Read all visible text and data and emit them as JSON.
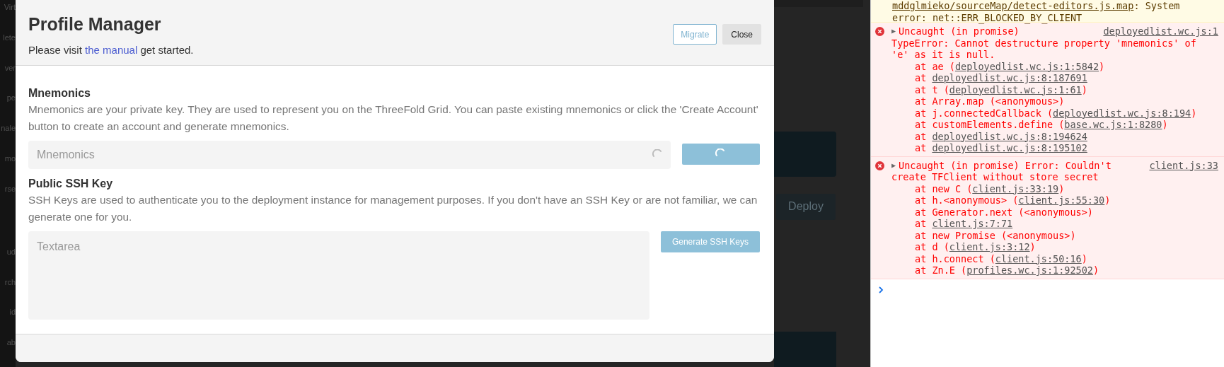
{
  "sidebar": {
    "items": [
      "Virt",
      "lete",
      "ver",
      "pe",
      "nale",
      "mo",
      "rse",
      "ud",
      "rch",
      "id",
      "ab"
    ]
  },
  "modal": {
    "title": "Profile Manager",
    "intro": {
      "before": "Please visit ",
      "link": "the manual",
      "after": " get started."
    },
    "buttons": [
      {
        "label": "Migrate",
        "kind": "outline"
      },
      {
        "label": "Close",
        "kind": "secondary"
      }
    ],
    "sections": [
      {
        "title": "Mnemonics",
        "description": "Mnemonics are your private key. They are used to represent you on the ThreeFold Grid. You can paste existing mnemonics or click the 'Create Account' button to create an account and generate mnemonics.",
        "field": {
          "kind": "input",
          "placeholder": "Mnemonics",
          "loading": true
        },
        "action": {
          "loading": true
        }
      },
      {
        "title": "Public SSH Key",
        "description": "SSH Keys are used to authenticate you to the deployment instance for management purposes. If you don't have an SSH Key or are not familiar, we can generate one for you.",
        "field": {
          "kind": "textarea",
          "placeholder": "Textarea",
          "loading": false
        },
        "action": {
          "loading": false,
          "label": "Generate SSH Keys"
        }
      }
    ]
  },
  "background": {
    "button": "Deploy"
  },
  "console": {
    "warning": {
      "link": "mddglmieko/sourceMap/detect-editors.js.map",
      "text": ": System error: net::ERR_BLOCKED_BY_CLIENT"
    },
    "errors": [
      {
        "toggle": "▶",
        "head": "Uncaught (in promise)",
        "source": "deployedlist.wc.js:1",
        "detail_lines": [
          "TypeError: Cannot destructure property 'mnemonics' of",
          "'e' as it is null."
        ],
        "frames": [
          {
            "text": "at ae (",
            "link": "deployedlist.wc.js:1:5842",
            "after": ")"
          },
          {
            "text": "at ",
            "link": "deployedlist.wc.js:8:187691"
          },
          {
            "text": "at t (",
            "link": "deployedlist.wc.js:1:61",
            "after": ")"
          },
          {
            "text": "at Array.map (<anonymous>)"
          },
          {
            "text": "at j.connectedCallback (",
            "link": "deployedlist.wc.js:8:194",
            "after": ")"
          },
          {
            "text": "at customElements.define (",
            "link": "base.wc.js:1:8280",
            "after": ")"
          },
          {
            "text": "at ",
            "link": "deployedlist.wc.js:8:194624"
          },
          {
            "text": "at ",
            "link": "deployedlist.wc.js:8:195102"
          }
        ]
      },
      {
        "toggle": "▶",
        "head": "Uncaught (in promise) Error: Couldn't",
        "source": "client.js:33",
        "detail_lines": [
          "create TFClient without store secret"
        ],
        "frames": [
          {
            "text": "at new C (",
            "link": "client.js:33:19",
            "after": ")"
          },
          {
            "text": "at h.<anonymous> (",
            "link": "client.js:55:30",
            "after": ")"
          },
          {
            "text": "at Generator.next (<anonymous>)"
          },
          {
            "text": "at ",
            "link": "client.js:7:71"
          },
          {
            "text": "at new Promise (<anonymous>)"
          },
          {
            "text": "at d (",
            "link": "client.js:3:12",
            "after": ")"
          },
          {
            "text": "at h.connect (",
            "link": "client.js:50:16",
            "after": ")"
          },
          {
            "text": "at Zn.E (",
            "link": "profiles.wc.js:1:92502",
            "after": ")"
          }
        ]
      }
    ]
  }
}
